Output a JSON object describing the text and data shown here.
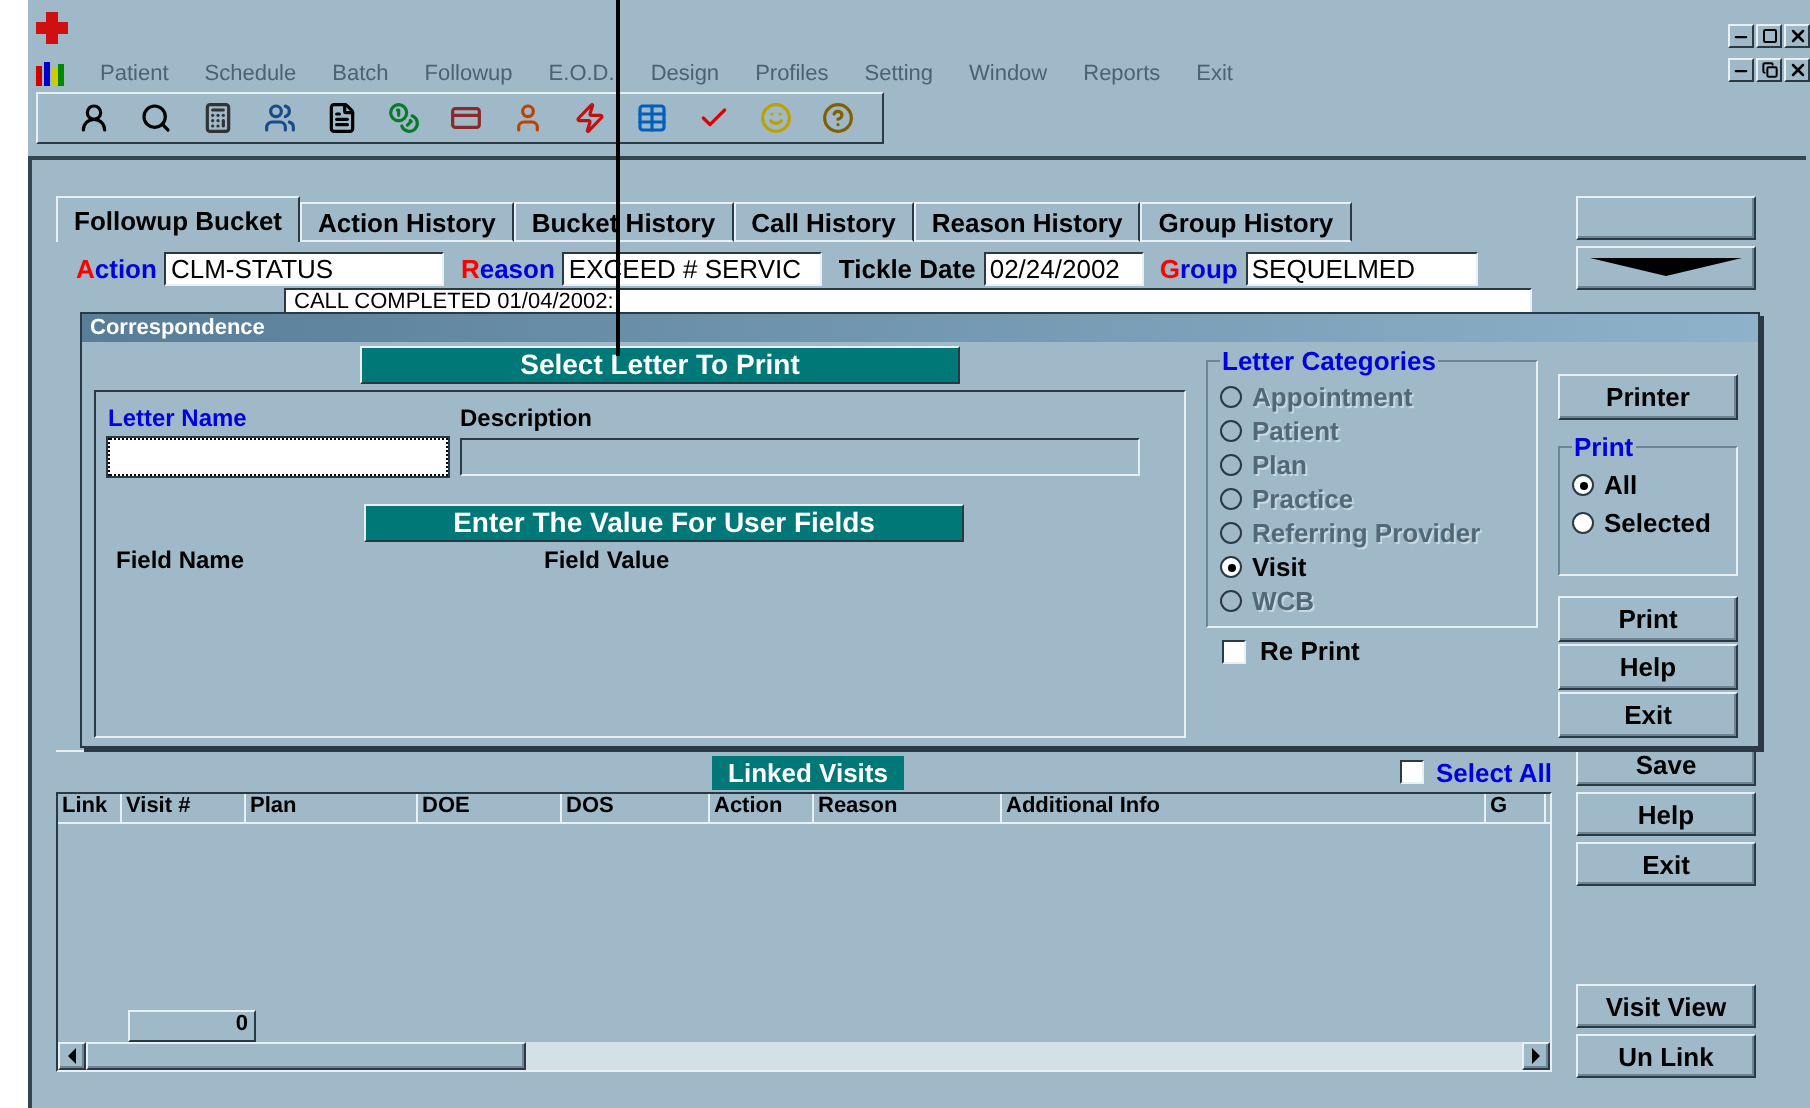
{
  "menu": [
    {
      "label": "Patient",
      "disabled": true
    },
    {
      "label": "Schedule",
      "disabled": true
    },
    {
      "label": "Batch",
      "disabled": true
    },
    {
      "label": "Followup",
      "disabled": true
    },
    {
      "label": "E.O.D.",
      "disabled": true
    },
    {
      "label": "Design",
      "disabled": true
    },
    {
      "label": "Profiles",
      "disabled": true
    },
    {
      "label": "Setting",
      "disabled": true
    },
    {
      "label": "Window",
      "disabled": true
    },
    {
      "label": "Reports",
      "disabled": true
    },
    {
      "label": "Exit",
      "disabled": true
    }
  ],
  "tabs": [
    {
      "label": "Followup Bucket",
      "selected": true
    },
    {
      "label": "Action History",
      "selected": false
    },
    {
      "label": "Bucket History",
      "selected": false
    },
    {
      "label": "Call History",
      "selected": false
    },
    {
      "label": "Reason History",
      "selected": false
    },
    {
      "label": "Group History",
      "selected": false
    }
  ],
  "fields": [
    {
      "label": "Action",
      "kind": "keyed",
      "value": "CLM-STATUS"
    },
    {
      "label": "Reason",
      "kind": "keyed",
      "value": "EXCEED # SERVIC"
    },
    {
      "label": "Tickle Date",
      "kind": "plain",
      "value": "02/24/2002"
    },
    {
      "label": "Group",
      "kind": "keyed",
      "value": "SEQUELMED"
    }
  ],
  "remark": "CALL COMPLETED 01/04/2002:",
  "side_buttons_top": [
    "Save",
    "Help",
    "Exit"
  ],
  "side_buttons_bottom": [
    "Visit View",
    "Un Link"
  ],
  "linked_visits": {
    "title": "Linked Visits",
    "select_all": {
      "label": "Select All",
      "checked": false
    },
    "columns": [
      "Link",
      "Visit #",
      "Plan",
      "DOE",
      "DOS",
      "Action",
      "Reason",
      "Additional Info",
      "G"
    ],
    "count": "0"
  },
  "dialog": {
    "title": "Correspondence",
    "banner": "Select Letter To Print",
    "letter_name_label": "Letter Name",
    "description_label": "Description",
    "user_fields_banner": "Enter The Value For User Fields",
    "field_name_label": "Field Name",
    "field_value_label": "Field Value",
    "categories_title": "Letter Categories",
    "categories": [
      {
        "label": "Appointment",
        "selected": false,
        "disabled": true
      },
      {
        "label": "Patient",
        "selected": false,
        "disabled": true
      },
      {
        "label": "Plan",
        "selected": false,
        "disabled": true
      },
      {
        "label": "Practice",
        "selected": false,
        "disabled": true
      },
      {
        "label": "Referring Provider",
        "selected": false,
        "disabled": true
      },
      {
        "label": "Visit",
        "selected": true,
        "disabled": false
      },
      {
        "label": "WCB",
        "selected": false,
        "disabled": true
      }
    ],
    "reprint": {
      "label": "Re Print",
      "checked": false
    },
    "printer_button": "Printer",
    "print_title": "Print",
    "print_options": [
      {
        "label": "All",
        "selected": true
      },
      {
        "label": "Selected",
        "selected": false
      }
    ],
    "buttons": [
      "Print",
      "Help",
      "Exit"
    ]
  }
}
